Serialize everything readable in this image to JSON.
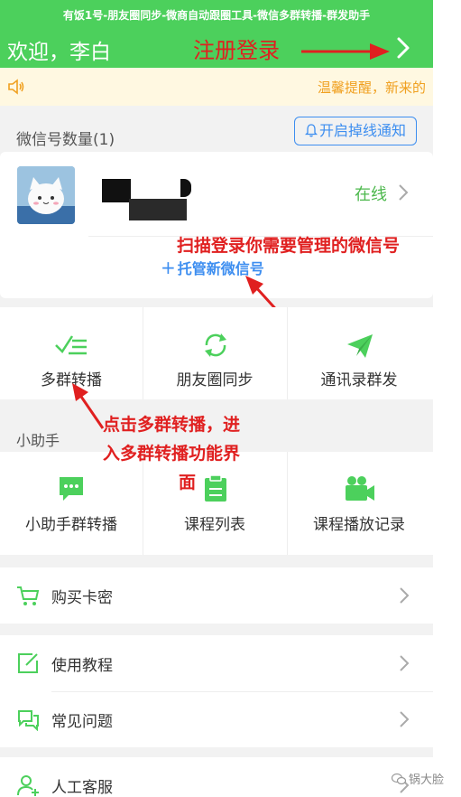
{
  "header": {
    "app_title": "有饭1号-朋友圈同步-微商自动跟圈工具-微信多群转播-群发助手",
    "welcome": "欢迎，李白",
    "register_login": "注册登录"
  },
  "notice": {
    "text": "温馨提醒，新来的"
  },
  "wechat": {
    "count_label": "微信号数量(1)",
    "notify_button": "开启掉线通知",
    "status": "在线",
    "add_account": "托管新微信号"
  },
  "annotations": {
    "scan_login": "扫描登录你需要管理的微信号",
    "click_multigroup_line1": "点击多群转播，进",
    "click_multigroup_line2": "入多群转播功能界",
    "click_multigroup_line3": "面"
  },
  "main_grid": [
    {
      "label": "多群转播",
      "icon": "multi-group-icon"
    },
    {
      "label": "朋友圈同步",
      "icon": "sync-icon"
    },
    {
      "label": "通讯录群发",
      "icon": "send-icon"
    }
  ],
  "assistant": {
    "title": "小助手",
    "items": [
      {
        "label": "小助手群转播",
        "icon": "chat-bubble-icon"
      },
      {
        "label": "课程列表",
        "icon": "clipboard-icon"
      },
      {
        "label": "课程播放记录",
        "icon": "video-camera-icon"
      }
    ]
  },
  "menu": {
    "buy_card": "购买卡密",
    "tutorial": "使用教程",
    "faq": "常见问题",
    "support": "人工客服"
  },
  "watermark": "锅大脸",
  "colors": {
    "primary": "#4cd05c",
    "accent_blue": "#3d8ef0",
    "annotation_red": "#e02020",
    "notice_orange": "#f0a020"
  }
}
